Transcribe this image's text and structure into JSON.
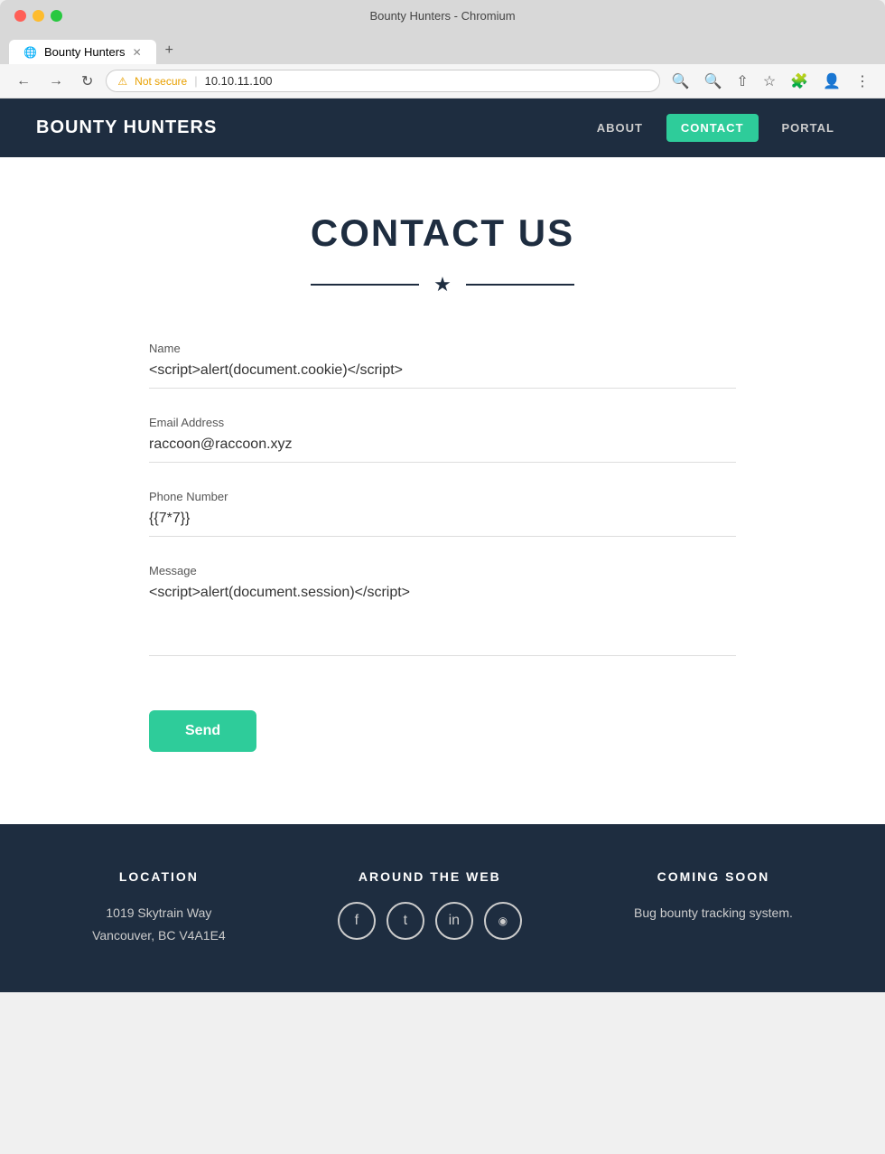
{
  "browser": {
    "title": "Bounty Hunters - Chromium",
    "tab_label": "Bounty Hunters",
    "address": "10.10.11.100",
    "warning_text": "Not secure"
  },
  "nav": {
    "logo": "BOUNTY HUNTERS",
    "links": [
      {
        "label": "ABOUT",
        "active": false
      },
      {
        "label": "CONTACT",
        "active": true
      },
      {
        "label": "PORTAL",
        "active": false
      }
    ]
  },
  "page": {
    "title": "CONTACT US"
  },
  "form": {
    "name_label": "Name",
    "name_value": "<script>alert(document.cookie)</script>",
    "email_label": "Email Address",
    "email_value": "raccoon@raccoon.xyz",
    "phone_label": "Phone Number",
    "phone_value": "{{7*7}}",
    "message_label": "Message",
    "message_value": "<script>alert(document.session)</script>",
    "send_label": "Send"
  },
  "footer": {
    "location_heading": "LOCATION",
    "location_line1": "1019 Skytrain Way",
    "location_line2": "Vancouver, BC V4A1E4",
    "web_heading": "AROUND THE WEB",
    "coming_heading": "COMING SOON",
    "coming_text": "Bug bounty tracking system.",
    "social": [
      {
        "name": "facebook-icon",
        "symbol": "f"
      },
      {
        "name": "twitter-icon",
        "symbol": "t"
      },
      {
        "name": "linkedin-icon",
        "symbol": "in"
      },
      {
        "name": "dribbble-icon",
        "symbol": "◉"
      }
    ]
  }
}
